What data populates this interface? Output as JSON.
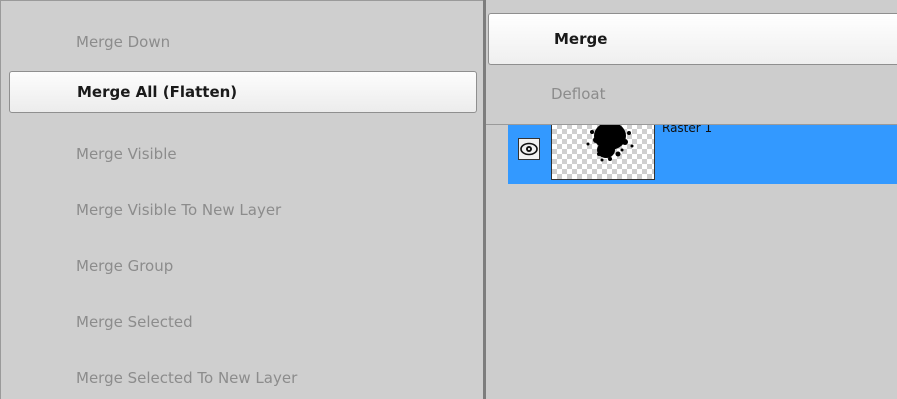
{
  "submenu": {
    "items": [
      {
        "label": "Merge Down",
        "enabled": false
      },
      {
        "label": "Merge All (Flatten)",
        "enabled": true,
        "highlighted": true
      },
      {
        "label": "Merge Visible",
        "enabled": false
      },
      {
        "label": "Merge Visible To New Layer",
        "enabled": false
      },
      {
        "label": "Merge Group",
        "enabled": false
      },
      {
        "label": "Merge Selected",
        "enabled": false
      },
      {
        "label": "Merge Selected To New Layer",
        "enabled": false
      }
    ]
  },
  "popup": {
    "items": [
      {
        "label": "Merge",
        "enabled": true,
        "highlighted": true
      },
      {
        "label": "Defloat",
        "enabled": false
      }
    ]
  },
  "layers": {
    "rows": [
      {
        "name": "Raster 1",
        "visible": true,
        "selected": true,
        "icon": "eye-icon"
      }
    ]
  },
  "colors": {
    "selection": "#3399ff",
    "menu_bg": "#cfcfcf",
    "disabled_text": "#8c8c8c"
  }
}
